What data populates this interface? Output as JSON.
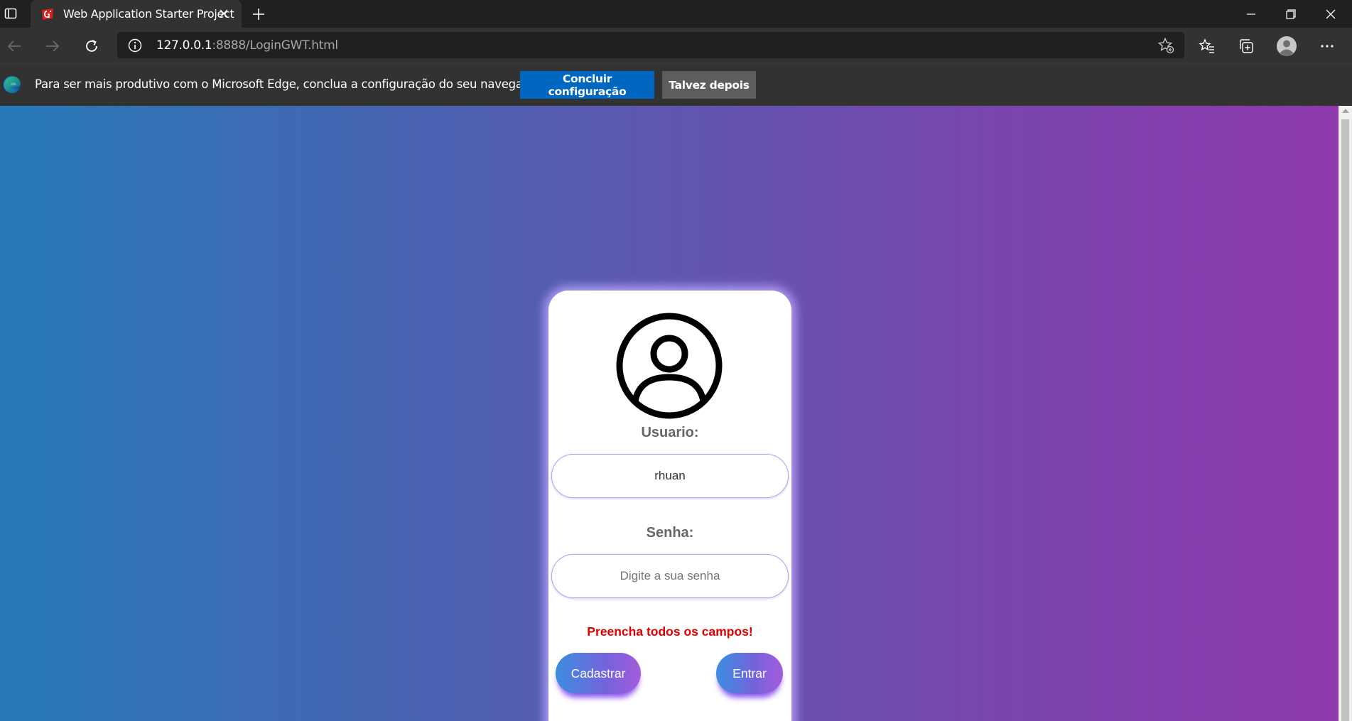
{
  "browser": {
    "tab": {
      "title": "Web Application Starter Project"
    },
    "address": {
      "host": "127.0.0.1",
      "rest": ":8888/LoginGWT.html"
    },
    "infobar": {
      "message": "Para ser mais produtivo com o Microsoft Edge, conclua a configuração do seu navegador.",
      "primary_label": "Concluir configuração",
      "secondary_label": "Talvez depois"
    },
    "icons": [
      "tab-actions-icon",
      "gwt-favicon",
      "close-icon",
      "plus-icon",
      "minimize-icon",
      "restore-icon",
      "close-window-icon",
      "back-icon",
      "forward-icon",
      "refresh-icon",
      "info-icon",
      "add-favorite-icon",
      "favorites-icon",
      "collections-icon",
      "profile-icon",
      "more-icon",
      "edge-logo-icon"
    ]
  },
  "login": {
    "user_label": "Usuario:",
    "user_value": "rhuan",
    "password_label": "Senha:",
    "password_placeholder": "Digite a sua senha",
    "error_message": "Preencha todos os campos!",
    "register_label": "Cadastrar",
    "enter_label": "Entrar"
  },
  "colors": {
    "gradient_start": "#2679b6",
    "gradient_end": "#8e3aad",
    "error": "#e00000",
    "primary_button": "#0067c0"
  }
}
